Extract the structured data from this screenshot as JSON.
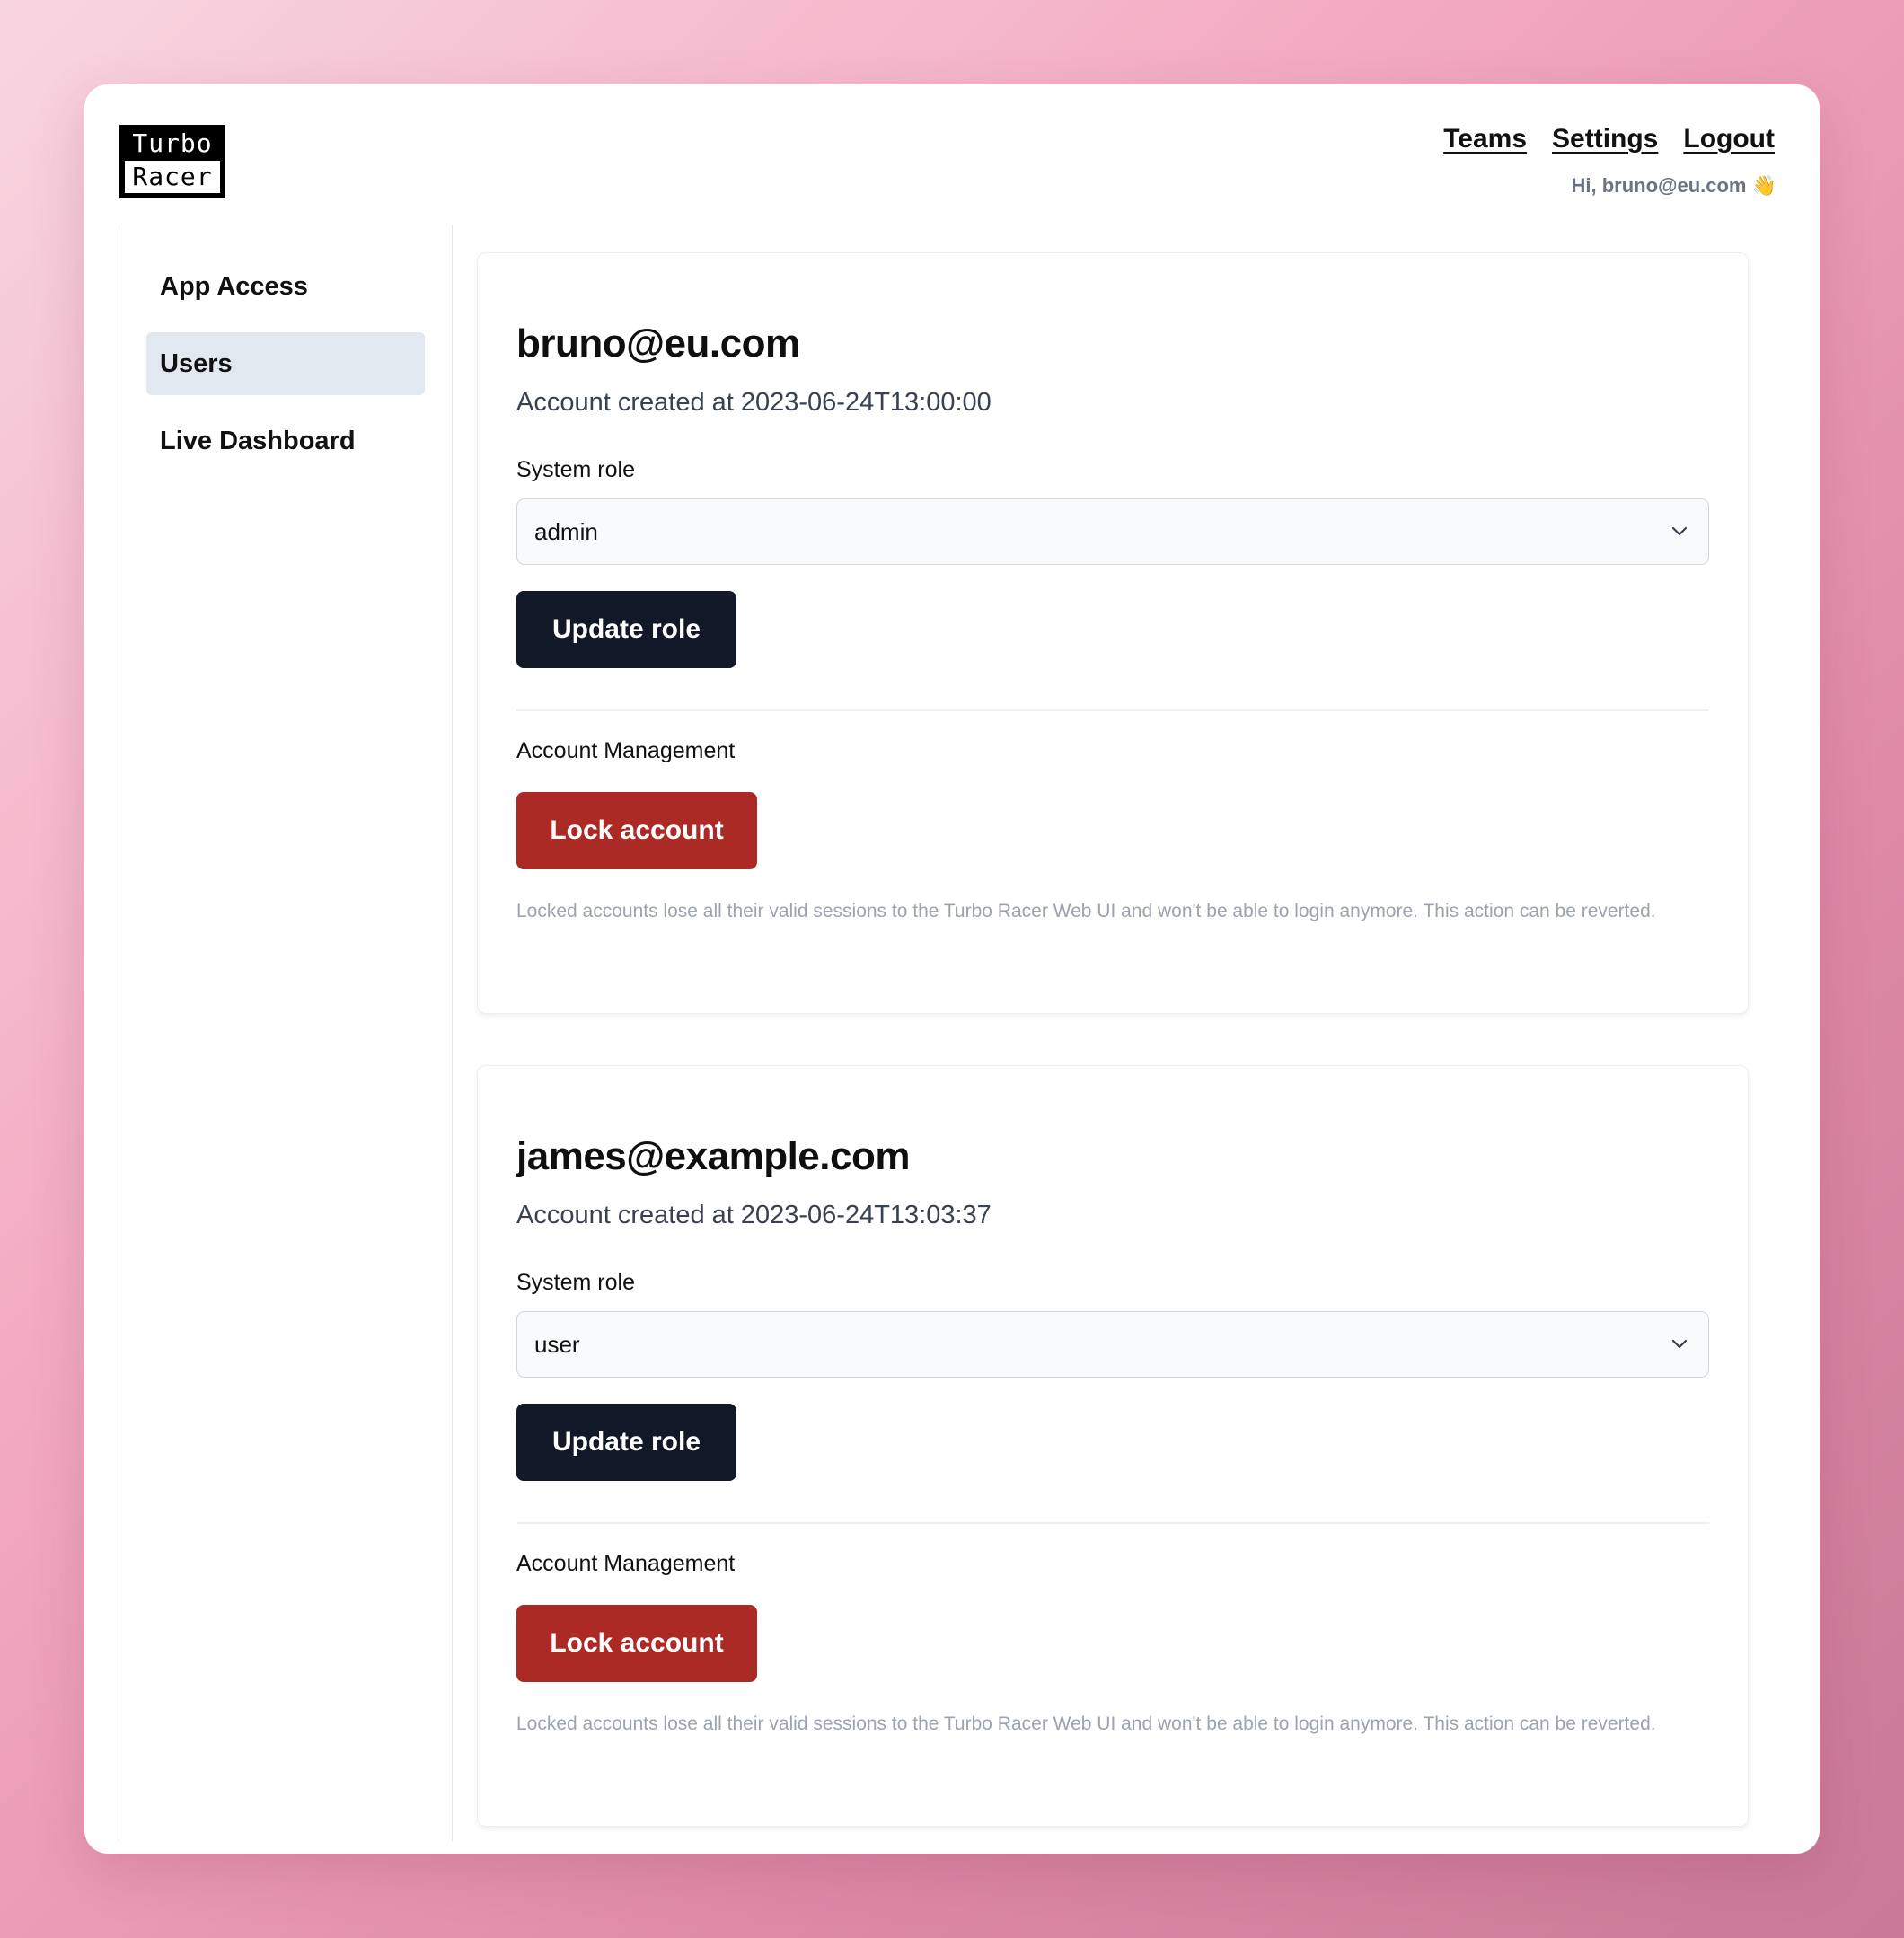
{
  "brand": {
    "line1": "Turbo",
    "line2": "Racer"
  },
  "topnav": {
    "teams": "Teams",
    "settings": "Settings",
    "logout": "Logout",
    "greeting": "Hi, bruno@eu.com 👋"
  },
  "sidebar": {
    "items": [
      {
        "label": "App Access"
      },
      {
        "label": "Users"
      },
      {
        "label": "Live Dashboard"
      }
    ]
  },
  "users": [
    {
      "email": "bruno@eu.com",
      "created": "Account created at 2023-06-24T13:00:00",
      "role_label": "System role",
      "role_value": "admin",
      "update_button": "Update role",
      "management_label": "Account Management",
      "lock_button": "Lock account",
      "help_text": "Locked accounts lose all their valid sessions to the Turbo Racer Web UI and won't be able to login anymore. This action can be reverted."
    },
    {
      "email": "james@example.com",
      "created": "Account created at 2023-06-24T13:03:37",
      "role_label": "System role",
      "role_value": "user",
      "update_button": "Update role",
      "management_label": "Account Management",
      "lock_button": "Lock account",
      "help_text": "Locked accounts lose all their valid sessions to the Turbo Racer Web UI and won't be able to login anymore. This action can be reverted."
    }
  ],
  "colors": {
    "primary_button": "#111827",
    "danger_button": "#ab2a26",
    "active_nav": "#e2e8f0"
  }
}
